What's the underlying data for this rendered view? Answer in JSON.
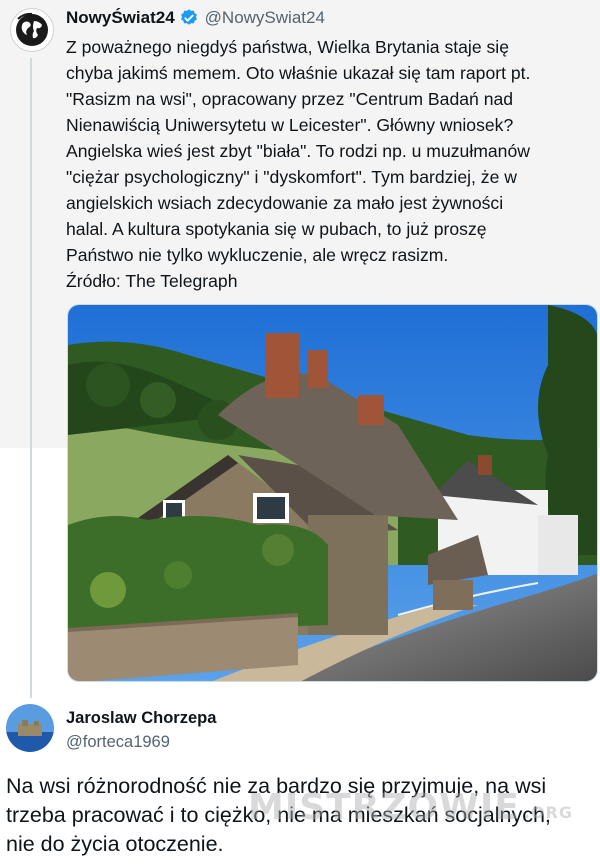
{
  "tweet": {
    "author_name": "NowyŚwiat24",
    "author_handle": "@NowySwiat24",
    "lines": [
      "Z poważnego niegdyś państwa, Wielka Brytania staje się",
      "chyba jakimś memem. Oto właśnie ukazał się tam raport pt.",
      "\"Rasizm na wsi\", opracowany przez \"Centrum Badań nad",
      "Nienawiścią Uniwersytetu w Leicester\". Główny wniosek?",
      "Angielska wieś jest zbyt \"biała\". To rodzi np. u muzułmanów",
      "\"ciężar psychologiczny\" i \"dyskomfort\". Tym bardziej, że w",
      "angielskich wsiach zdecydowanie za mało jest żywności",
      "halal. A kultura spotykania się w pubach, to już proszę",
      "Państwo nie tylko wykluczenie, ale wręcz rasizm.",
      "Źródło: The Telegraph"
    ],
    "verified_color": "#1d9bf0"
  },
  "reply": {
    "author_name": "Jaroslaw Chorzepa",
    "author_handle": "@forteca1969",
    "lines": [
      "Na wsi różnorodność nie za bardzo się przyjmuje, na wsi",
      "trzeba pracować i to ciężko, nie ma mieszkań socjalnych,",
      "nie do życia otoczenie."
    ]
  },
  "watermark": {
    "text": "MISTRZOWIE",
    "suffix": ".ORG"
  }
}
